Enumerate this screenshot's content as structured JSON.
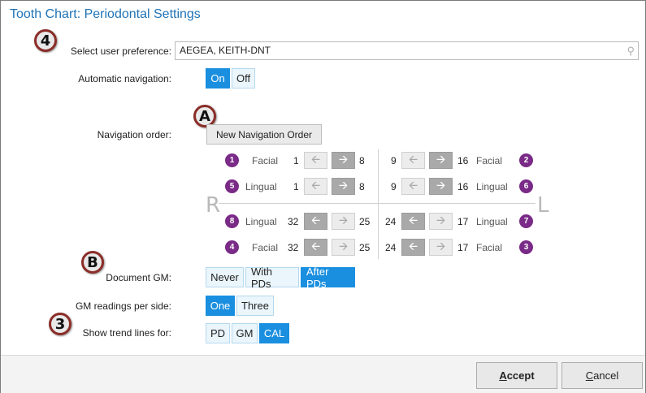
{
  "title": "Tooth Chart: Periodontal Settings",
  "markers": {
    "m4": "4",
    "mA": "A",
    "mB": "B",
    "m3": "3"
  },
  "user_pref": {
    "label": "Select user preference:",
    "value": "AEGEA, KEITH-DNT",
    "icon": "search-icon"
  },
  "auto_nav": {
    "label": "Automatic navigation:",
    "options": [
      "On",
      "Off"
    ],
    "selected": "On"
  },
  "nav_order": {
    "label": "Navigation order:",
    "button": "New Navigation Order",
    "right_letter": "R",
    "left_letter": "L",
    "rows": [
      {
        "left": {
          "badge": "1",
          "surface": "Facial",
          "start": "1",
          "end": "8"
        },
        "right": {
          "badge": "2",
          "surface": "Facial",
          "start": "9",
          "end": "16"
        }
      },
      {
        "left": {
          "badge": "5",
          "surface": "Lingual",
          "start": "1",
          "end": "8"
        },
        "right": {
          "badge": "6",
          "surface": "Lingual",
          "start": "9",
          "end": "16"
        }
      },
      {
        "left": {
          "badge": "8",
          "surface": "Lingual",
          "start": "32",
          "end": "25"
        },
        "right": {
          "badge": "7",
          "surface": "Lingual",
          "start": "24",
          "end": "17"
        }
      },
      {
        "left": {
          "badge": "4",
          "surface": "Facial",
          "start": "32",
          "end": "25"
        },
        "right": {
          "badge": "3",
          "surface": "Facial",
          "start": "24",
          "end": "17"
        }
      }
    ]
  },
  "document_gm": {
    "label": "Document GM:",
    "options": [
      "Never",
      "With PDs",
      "After PDs"
    ],
    "selected": "After PDs"
  },
  "gm_readings": {
    "label": "GM readings per side:",
    "options": [
      "One",
      "Three"
    ],
    "selected": "One"
  },
  "trend_lines": {
    "label": "Show trend lines for:",
    "options": [
      "PD",
      "GM",
      "CAL"
    ],
    "selected": "CAL"
  },
  "footer": {
    "accept_u": "A",
    "accept_rest": "ccept",
    "cancel_u": "C",
    "cancel_rest": "ancel"
  },
  "colors": {
    "accent": "#1a8fe0",
    "title": "#1f73b7",
    "badge": "#7a2a87",
    "marker_border": "#8b2d28"
  }
}
